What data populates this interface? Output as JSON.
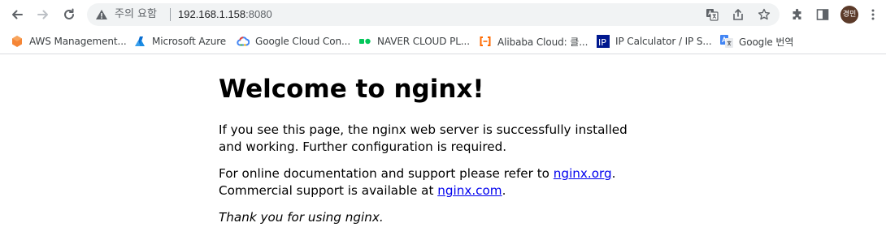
{
  "browser": {
    "security_label": "주의 요함",
    "url_host": "192.168.1.158",
    "url_port": ":8080",
    "avatar_text": "경민",
    "icons": {
      "back": "arrow-left-icon",
      "forward": "arrow-right-icon",
      "reload": "reload-icon",
      "warning": "warning-triangle-icon",
      "translate": "translate-icon",
      "share": "share-icon",
      "bookmark": "star-icon",
      "extensions": "puzzle-icon",
      "side_panel": "side-panel-icon",
      "menu": "kebab-menu-icon"
    }
  },
  "bookmarks": [
    {
      "label": "AWS Management...",
      "icon": "aws-icon"
    },
    {
      "label": "Microsoft Azure",
      "icon": "azure-icon"
    },
    {
      "label": "Google Cloud Con...",
      "icon": "google-cloud-icon"
    },
    {
      "label": "NAVER CLOUD PL...",
      "icon": "naver-cloud-icon"
    },
    {
      "label": "Alibaba Cloud: 클...",
      "icon": "alibaba-cloud-icon"
    },
    {
      "label": "IP Calculator / IP S...",
      "icon": "ip-calculator-icon"
    },
    {
      "label": "Google 번역",
      "icon": "google-translate-icon"
    }
  ],
  "page": {
    "heading": "Welcome to nginx!",
    "para1": "If you see this page, the nginx web server is successfully installed and working. Further configuration is required.",
    "para2_pre": "For online documentation and support please refer to ",
    "para2_link1": "nginx.org",
    "para2_mid": ".",
    "para2_line2": "Commercial support is available at ",
    "para2_link2": "nginx.com",
    "para2_end": ".",
    "para3": "Thank you for using nginx."
  },
  "colors": {
    "link": "#0000ee",
    "toolbar_bg": "#ffffff",
    "omnibox_bg": "#f1f3f4",
    "avatar_bg": "#5b3a29"
  }
}
